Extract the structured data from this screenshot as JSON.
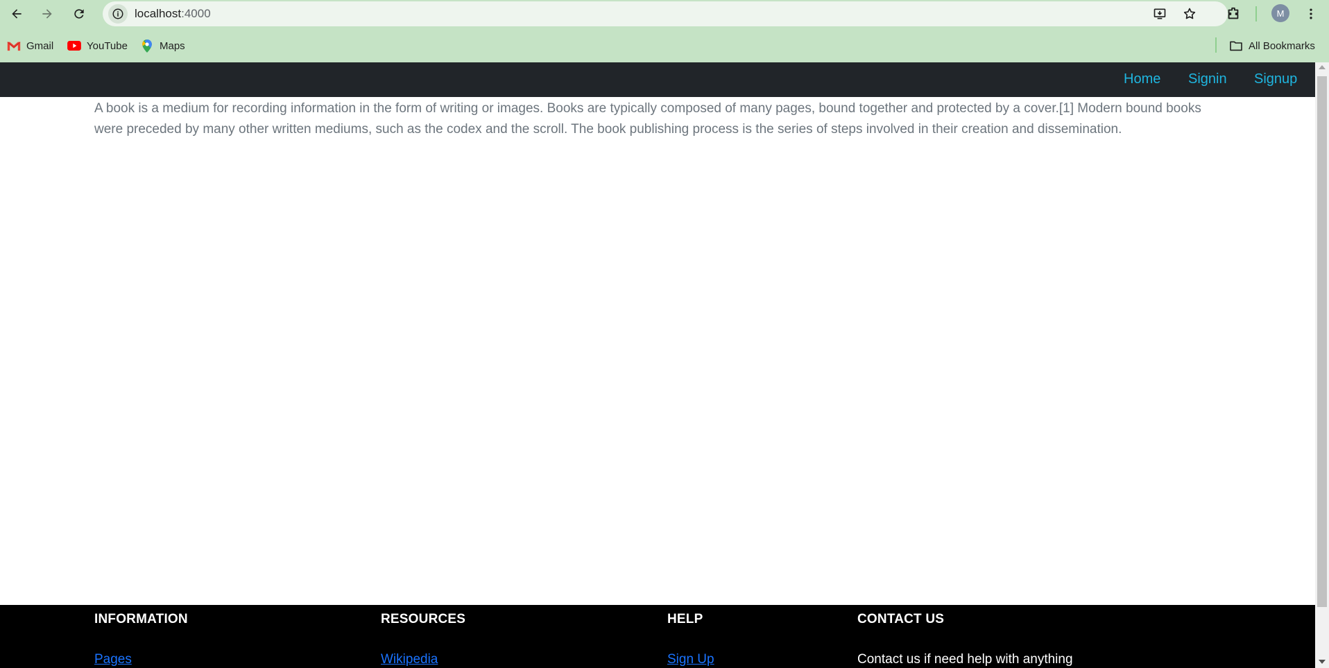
{
  "browser": {
    "url_host": "localhost",
    "url_port": ":4000",
    "profile_initial": "M",
    "bookmarks": [
      {
        "label": "Gmail",
        "icon": "gmail-icon"
      },
      {
        "label": "YouTube",
        "icon": "youtube-icon"
      },
      {
        "label": "Maps",
        "icon": "maps-icon"
      }
    ],
    "all_bookmarks_label": "All Bookmarks"
  },
  "navbar": {
    "links": [
      "Home",
      "Signin",
      "Signup"
    ]
  },
  "main": {
    "paragraph": "A book is a medium for recording information in the form of writing or images. Books are typically composed of many pages, bound together and protected by a cover.[1] Modern bound books were preceded by many other written mediums, such as the codex and the scroll. The book publishing process is the series of steps involved in their creation and dissemination."
  },
  "footer": {
    "columns": [
      {
        "heading": "INFORMATION",
        "link": "Pages"
      },
      {
        "heading": "RESOURCES",
        "link": "Wikipedia"
      },
      {
        "heading": "HELP",
        "link": "Sign Up"
      },
      {
        "heading": "CONTACT US",
        "text": "Contact us if need help with anything"
      }
    ]
  },
  "colors": {
    "chrome_bg": "#c5e3c5",
    "navbar_bg": "#212529",
    "nav_link": "#1fb6e0",
    "footer_bg": "#000000",
    "footer_link": "#1a73ff",
    "body_text": "#6c757d"
  }
}
